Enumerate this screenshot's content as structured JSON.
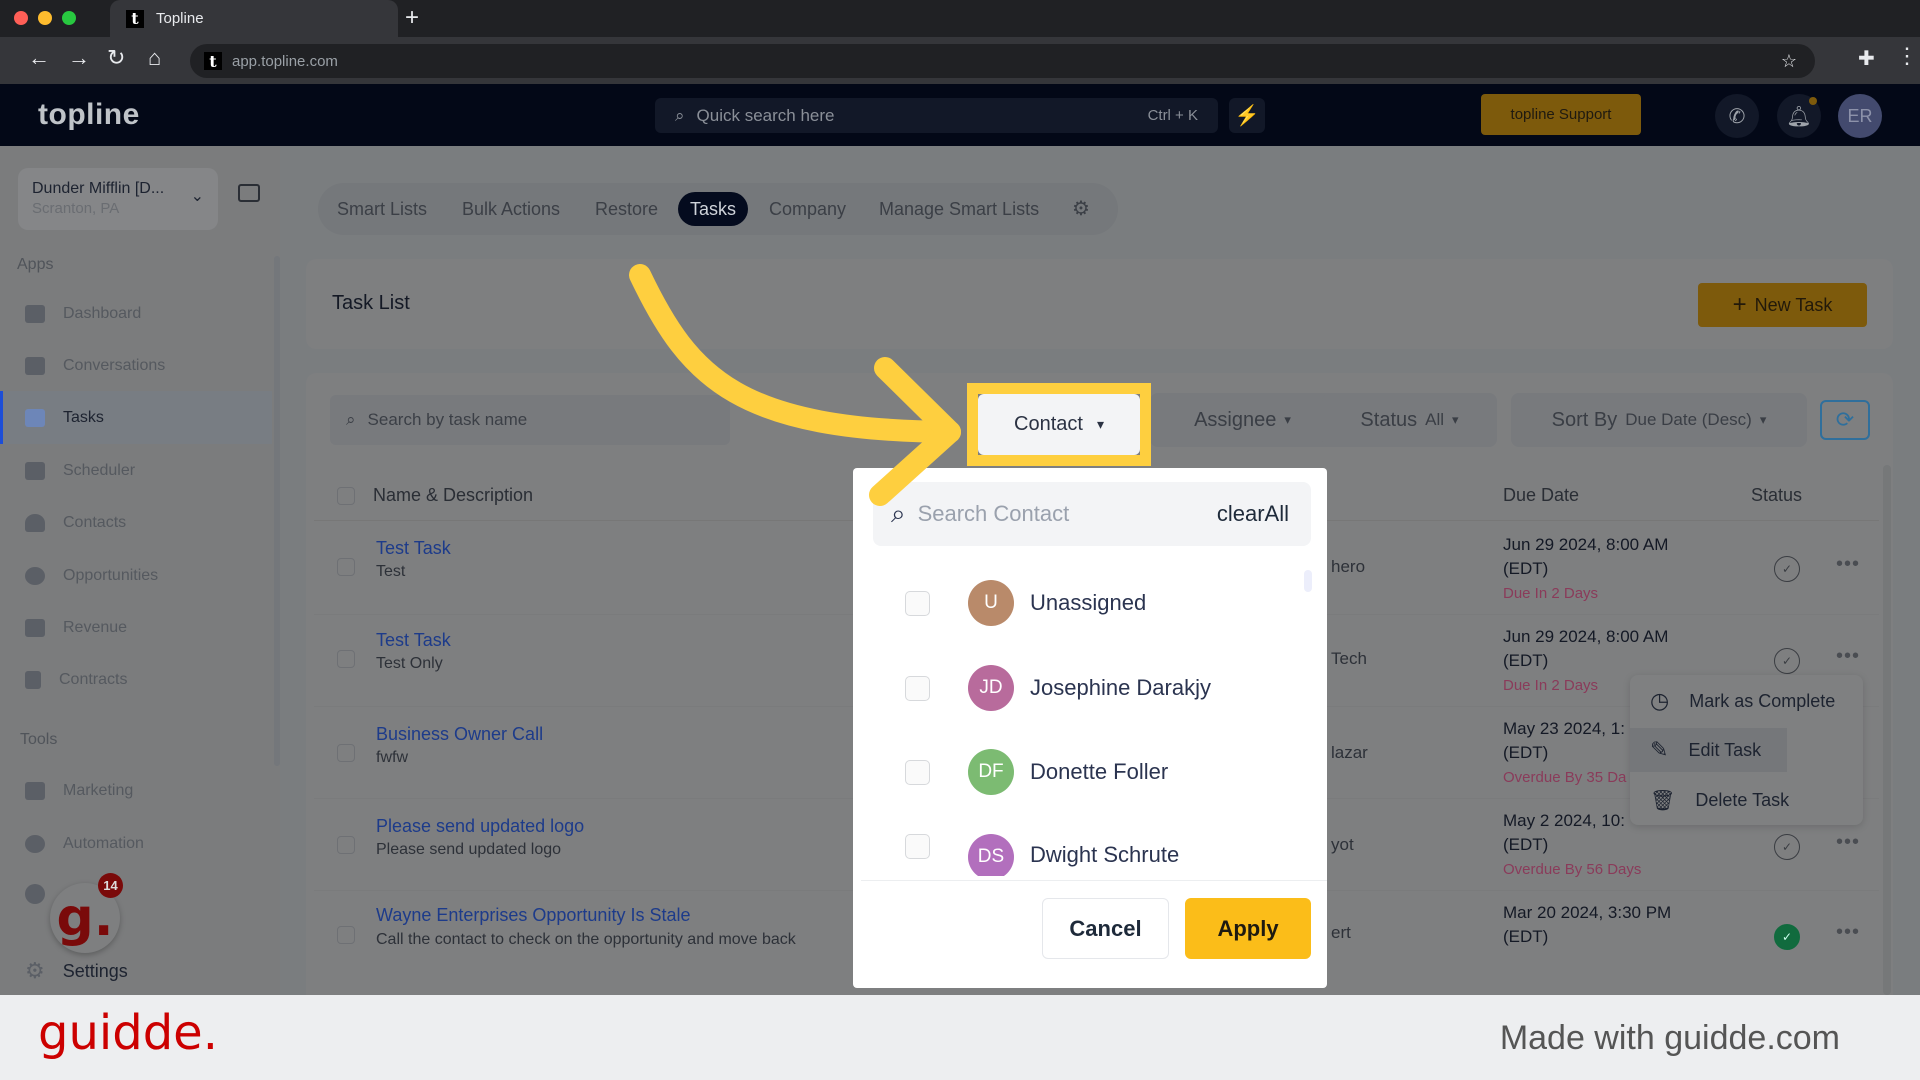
{
  "browser": {
    "tab_title": "Topline",
    "url": "app.topline.com",
    "favicon_letter": "t"
  },
  "header": {
    "logo": "topline",
    "quick_search_placeholder": "Quick search here",
    "quick_search_shortcut": "Ctrl + K",
    "support_label": "topline Support",
    "avatar_initials": "ER"
  },
  "sidebar": {
    "account_name": "Dunder Mifflin [D...",
    "account_location": "Scranton, PA",
    "apps_label": "Apps",
    "apps": [
      {
        "label": "Dashboard",
        "active": false
      },
      {
        "label": "Conversations",
        "active": false
      },
      {
        "label": "Tasks",
        "active": true
      },
      {
        "label": "Scheduler",
        "active": false
      },
      {
        "label": "Contacts",
        "active": false
      },
      {
        "label": "Opportunities",
        "active": false
      },
      {
        "label": "Revenue",
        "active": false
      },
      {
        "label": "Contracts",
        "active": false
      }
    ],
    "tools_label": "Tools",
    "tools": [
      {
        "label": "Marketing"
      },
      {
        "label": "Automation"
      }
    ],
    "settings_label": "Settings",
    "guidde_badge_count": "14"
  },
  "topnav": {
    "items": [
      "Smart Lists",
      "Bulk Actions",
      "Restore",
      "Tasks",
      "Company",
      "Manage Smart Lists"
    ],
    "active": "Tasks"
  },
  "tasklist": {
    "title": "Task List",
    "new_task_label": "New Task",
    "search_placeholder": "Search by task name",
    "filters": {
      "contact": "Contact",
      "assignee": "Assignee",
      "status_label": "Status",
      "status_value": "All",
      "sort_label": "Sort By",
      "sort_value": "Due Date (Desc)"
    },
    "columns": {
      "name": "Name & Description",
      "due_date": "Due Date",
      "status": "Status"
    },
    "rows": [
      {
        "title": "Test Task",
        "desc": "Test",
        "contact_partial": "hero",
        "due": "Jun 29 2024, 8:00 AM",
        "tz": "(EDT)",
        "relative": "Due In 2 Days",
        "complete": false
      },
      {
        "title": "Test Task",
        "desc": "Test Only",
        "contact_partial": "Tech",
        "due": "Jun 29 2024, 8:00 AM",
        "tz": "(EDT)",
        "relative": "Due In 2 Days",
        "complete": false
      },
      {
        "title": "Business Owner Call",
        "desc": "fwfw",
        "contact_partial": "lazar",
        "due": "May 23 2024, 1:",
        "tz": "(EDT)",
        "relative": "Overdue By 35 Da",
        "complete": false
      },
      {
        "title": "Please send updated logo",
        "desc": "Please send updated logo",
        "contact_partial": "yot",
        "due": "May 2 2024, 10:",
        "tz": "(EDT)",
        "relative": "Overdue By 56 Days",
        "complete": false
      },
      {
        "title": "Wayne Enterprises Opportunity Is Stale",
        "desc": "Call the contact to check on the opportunity and move back",
        "contact_partial": "ert",
        "due": "Mar 20 2024, 3:30 PM",
        "tz": "(EDT)",
        "relative": "",
        "complete": true
      }
    ]
  },
  "contact_dropdown": {
    "search_placeholder": "Search Contact",
    "clear_all_label": "clearAll",
    "options": [
      {
        "initials": "U",
        "name": "Unassigned",
        "color": "#b98a6a",
        "checked": false
      },
      {
        "initials": "JD",
        "name": "Josephine Darakjy",
        "color": "#b86b9c",
        "checked": false
      },
      {
        "initials": "DF",
        "name": "Donette Foller",
        "color": "#7cbb72",
        "checked": false
      },
      {
        "initials": "DS",
        "name": "Dwight Schrute",
        "color": "#b26fbd",
        "checked": false
      }
    ],
    "cancel_label": "Cancel",
    "apply_label": "Apply"
  },
  "context_menu": {
    "items": [
      "Mark as Complete",
      "Edit Task",
      "Delete Task"
    ],
    "hovered": "Edit Task"
  },
  "footer": {
    "brand": "guidde.",
    "made_with": "Made with guidde.com"
  },
  "colors": {
    "highlight": "#fecf3f",
    "apply": "#fbbd19",
    "brand_red": "#cc0000",
    "link_blue": "#1d3b8a"
  }
}
